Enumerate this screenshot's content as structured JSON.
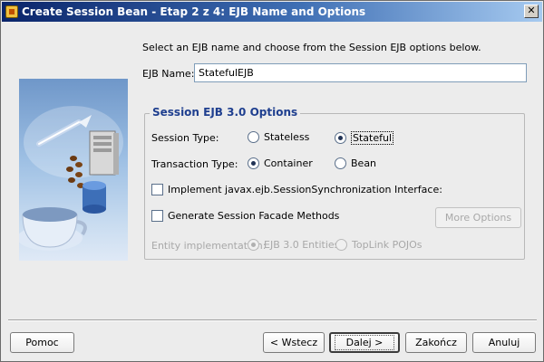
{
  "window": {
    "title": "Create Session Bean - Etap 2 z 4: EJB Name and Options",
    "close_glyph": "✕"
  },
  "illustration": {
    "name": "session-bean-wizard-illustration"
  },
  "form": {
    "instructions": "Select an EJB name and choose from the Session EJB options below.",
    "ejb_name_label": "EJB Name:",
    "ejb_name_value": "StatefulEJB"
  },
  "options": {
    "title": "Session EJB 3.0 Options",
    "session_type_label": "Session Type:",
    "session_types": [
      {
        "label": "Stateless",
        "selected": false
      },
      {
        "label": "Stateful",
        "selected": true
      }
    ],
    "transaction_type_label": "Transaction Type:",
    "transaction_types": [
      {
        "label": "Container",
        "selected": true
      },
      {
        "label": "Bean",
        "selected": false
      }
    ],
    "implement_sync_label": "Implement javax.ejb.SessionSynchronization Interface:",
    "implement_sync_checked": false,
    "generate_facade_label": "Generate Session Facade Methods",
    "generate_facade_checked": false,
    "more_options_label": "More Options",
    "entity_impl_label": "Entity implementation:",
    "entity_impls": [
      {
        "label": "EJB 3.0 Entities",
        "selected": true
      },
      {
        "label": "TopLink POJOs",
        "selected": false
      }
    ]
  },
  "buttons": {
    "help": "Pomoc",
    "back": "< Wstecz",
    "next": "Dalej >",
    "finish": "Zakończ",
    "cancel": "Anuluj"
  },
  "colors": {
    "title_gradient_start": "#0a246a",
    "group_title": "#1f3f8f",
    "dialog_bg": "#ececec"
  }
}
